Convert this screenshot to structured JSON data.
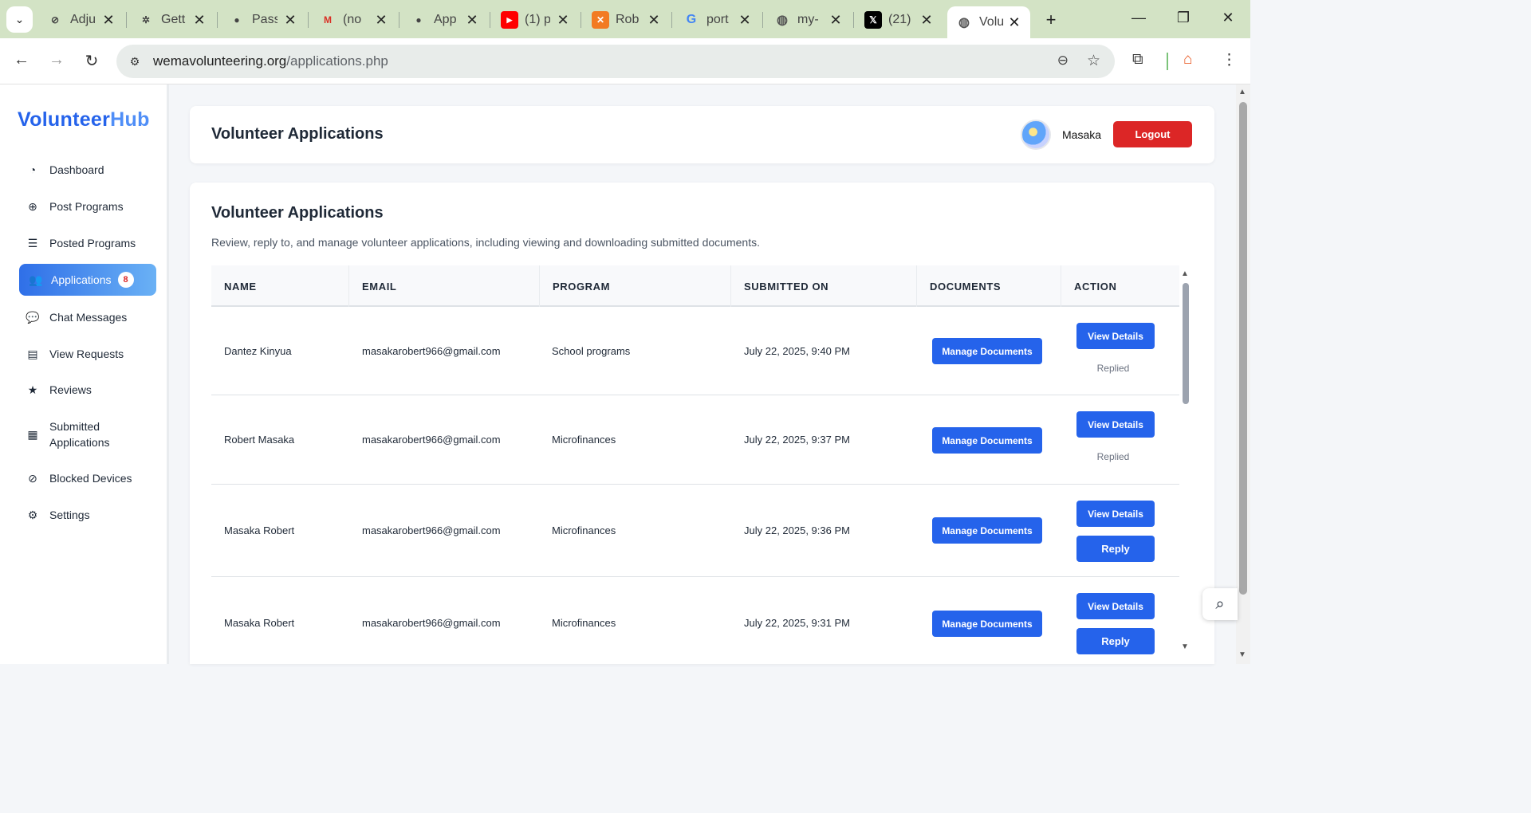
{
  "browser": {
    "tabs": [
      {
        "title": "Adju",
        "icon": "settings-swirl-icon",
        "glyph": "⊘"
      },
      {
        "title": "Gett",
        "icon": "openai-icon",
        "glyph": "✲"
      },
      {
        "title": "Pass",
        "icon": "github-icon",
        "glyph": "●"
      },
      {
        "title": "(no",
        "icon": "gmail-icon",
        "glyph": "M"
      },
      {
        "title": "App",
        "icon": "github-icon",
        "glyph": "●"
      },
      {
        "title": "(1) p",
        "icon": "youtube-icon",
        "glyph": "▶"
      },
      {
        "title": "Rob",
        "icon": "xampp-icon",
        "glyph": "✕"
      },
      {
        "title": "port",
        "icon": "google-icon",
        "glyph": "G"
      },
      {
        "title": "my-",
        "icon": "globe-icon",
        "glyph": "◍"
      },
      {
        "title": "(21)",
        "icon": "x-twitter-icon",
        "glyph": "𝕏"
      },
      {
        "title": "Volu",
        "icon": "globe-icon",
        "glyph": "◍"
      }
    ],
    "url_host": "wemavolunteering.org",
    "url_path": "/applications.php"
  },
  "sidebar": {
    "brand_a": "Volunteer",
    "brand_b": "Hub",
    "items": [
      {
        "label": "Dashboard",
        "icon": "gauge-icon",
        "glyph": "◔"
      },
      {
        "label": "Post Programs",
        "icon": "plus-circle-icon",
        "glyph": "⊕"
      },
      {
        "label": "Posted Programs",
        "icon": "list-icon",
        "glyph": "☰"
      },
      {
        "label": "Applications",
        "icon": "users-icon",
        "glyph": "👥",
        "badge": "8"
      },
      {
        "label": "Chat Messages",
        "icon": "comments-icon",
        "glyph": "💬"
      },
      {
        "label": "View Requests",
        "icon": "file-icon",
        "glyph": "▤"
      },
      {
        "label": "Reviews",
        "icon": "star-icon",
        "glyph": "★"
      },
      {
        "label": "Submitted Applications",
        "icon": "clipboard-icon",
        "glyph": "▦"
      },
      {
        "label": "Blocked Devices",
        "icon": "ban-icon",
        "glyph": "⊘"
      },
      {
        "label": "Settings",
        "icon": "gear-icon",
        "glyph": "⚙"
      }
    ]
  },
  "header": {
    "title": "Volunteer Applications",
    "user_name": "Masaka",
    "logout_label": "Logout"
  },
  "main": {
    "title": "Volunteer Applications",
    "description": "Review, reply to, and manage volunteer applications, including viewing and downloading submitted documents.",
    "columns": [
      "NAME",
      "EMAIL",
      "PROGRAM",
      "SUBMITTED ON",
      "DOCUMENTS",
      "ACTION"
    ],
    "rows": [
      {
        "name": "Dantez Kinyua",
        "email": "masakarobert966@gmail.com",
        "program": "School programs",
        "submitted": "July 22, 2025, 9:40 PM",
        "documents_label": "Manage Documents",
        "view_label": "View Details",
        "status": "Replied",
        "reply_label": ""
      },
      {
        "name": "Robert Masaka",
        "email": "masakarobert966@gmail.com",
        "program": "Microfinances",
        "submitted": "July 22, 2025, 9:37 PM",
        "documents_label": "Manage Documents",
        "view_label": "View Details",
        "status": "Replied",
        "reply_label": ""
      },
      {
        "name": "Masaka Robert",
        "email": "masakarobert966@gmail.com",
        "program": "Microfinances",
        "submitted": "July 22, 2025, 9:36 PM",
        "documents_label": "Manage Documents",
        "view_label": "View Details",
        "status": "",
        "reply_label": "Reply"
      },
      {
        "name": "Masaka Robert",
        "email": "masakarobert966@gmail.com",
        "program": "Microfinances",
        "submitted": "July 22, 2025, 9:31 PM",
        "documents_label": "Manage Documents",
        "view_label": "View Details",
        "status": "",
        "reply_label": "Reply"
      }
    ]
  }
}
